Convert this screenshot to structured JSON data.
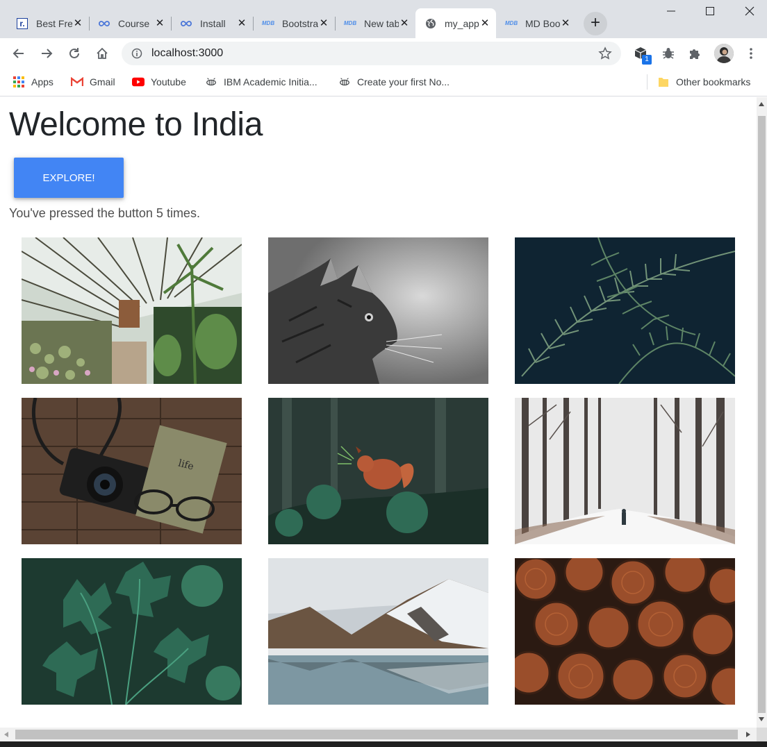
{
  "tabs": [
    {
      "title": "Best Free",
      "favicon": "r",
      "active": false
    },
    {
      "title": "Course",
      "favicon": "infinity",
      "active": false
    },
    {
      "title": "Install",
      "favicon": "infinity",
      "active": false
    },
    {
      "title": "Bootstrap",
      "favicon": "mdb",
      "active": false
    },
    {
      "title": "New tab",
      "favicon": "mdb",
      "active": false
    },
    {
      "title": "my_app",
      "favicon": "globe",
      "active": true
    },
    {
      "title": "MD Bootstrap",
      "favicon": "mdb",
      "active": false
    }
  ],
  "address_bar": {
    "url": "localhost:3000"
  },
  "extensions": {
    "badge_count": "1"
  },
  "bookmarks": [
    {
      "label": "Apps",
      "icon": "apps-grid-icon"
    },
    {
      "label": "Gmail",
      "icon": "gmail-icon"
    },
    {
      "label": "Youtube",
      "icon": "youtube-icon"
    },
    {
      "label": "IBM Academic Initia...",
      "icon": "ibm-bee-icon"
    },
    {
      "label": "Create your first No...",
      "icon": "ibm-bee-icon"
    }
  ],
  "other_bookmarks": "Other bookmarks",
  "page": {
    "heading": "Welcome to India",
    "button_label": "EXPLORE!",
    "counter_text": "You've pressed the button 5 times."
  },
  "gallery": [
    {
      "subject": "greenhouse"
    },
    {
      "subject": "cat"
    },
    {
      "subject": "fern"
    },
    {
      "subject": "camera"
    },
    {
      "subject": "squirrel"
    },
    {
      "subject": "winter-forest"
    },
    {
      "subject": "parsley"
    },
    {
      "subject": "mountain-lake"
    },
    {
      "subject": "firewood"
    }
  ],
  "colors": {
    "primary": "#4285f4",
    "tab_bg": "#dee1e6"
  }
}
